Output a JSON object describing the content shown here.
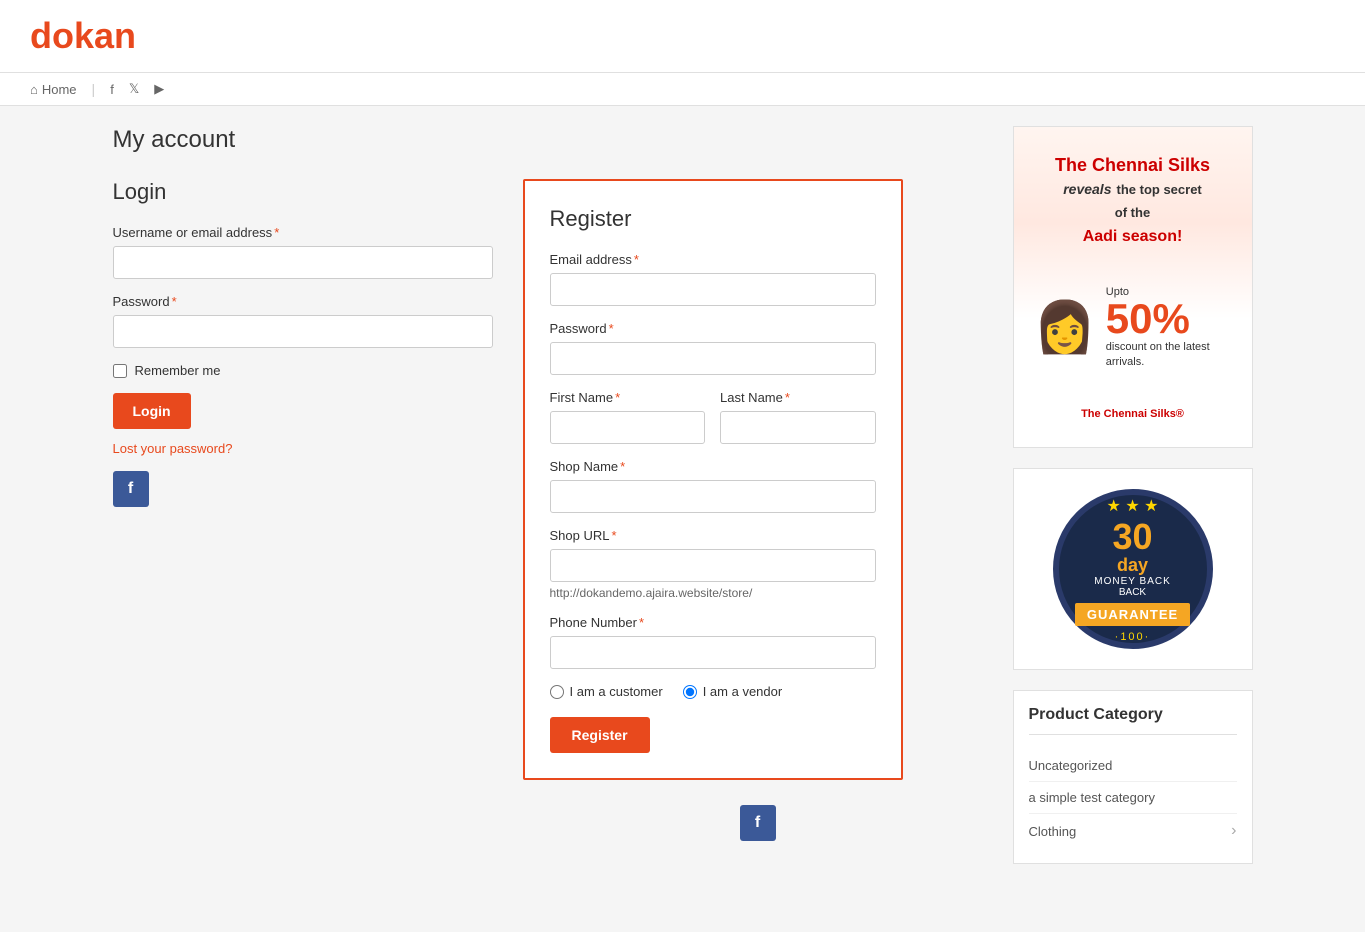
{
  "site": {
    "logo_prefix": "d",
    "logo_text": "okan"
  },
  "nav": {
    "home_label": "Home",
    "icons": [
      "facebook-nav-icon",
      "twitter-nav-icon",
      "youtube-nav-icon"
    ]
  },
  "page": {
    "title": "My account"
  },
  "login": {
    "title": "Login",
    "username_label": "Username or email address",
    "username_placeholder": "",
    "password_label": "Password",
    "password_placeholder": "",
    "remember_label": "Remember me",
    "login_btn": "Login",
    "lost_password": "Lost your password?",
    "facebook_letter": "f"
  },
  "register": {
    "title": "Register",
    "email_label": "Email address",
    "email_placeholder": "",
    "password_label": "Password",
    "password_placeholder": "",
    "firstname_label": "First Name",
    "firstname_placeholder": "",
    "lastname_label": "Last Name",
    "lastname_placeholder": "",
    "shopname_label": "Shop Name",
    "shopname_placeholder": "",
    "shopurl_label": "Shop URL",
    "shopurl_placeholder": "",
    "shopurl_hint": "http://dokandemo.ajaira.website/store/",
    "phone_label": "Phone Number",
    "phone_placeholder": "",
    "role_customer": "I am a customer",
    "role_vendor": "I am a vendor",
    "register_btn": "Register",
    "facebook_letter": "f"
  },
  "sidebar": {
    "ad_title_line1": "The Chennai Silks",
    "ad_title_line2": "reveals",
    "ad_title_line3": "the top secret",
    "ad_title_line4": "of the",
    "ad_title_line5": "Aadi season!",
    "ad_discount_percent": "50%",
    "ad_discount_text": "discount on the latest arrivals.",
    "guarantee_stars": "★ ★ ★",
    "guarantee_30": "30",
    "guarantee_day_text": "day",
    "guarantee_money": "MONEY BACK",
    "guarantee_label": "GUARANTEE",
    "guarantee_100": "·100·",
    "product_category_title": "Product Category",
    "categories": [
      {
        "name": "Uncategorized",
        "has_arrow": false
      },
      {
        "name": "a simple test category",
        "has_arrow": false
      },
      {
        "name": "Clothing",
        "has_arrow": true
      }
    ]
  }
}
